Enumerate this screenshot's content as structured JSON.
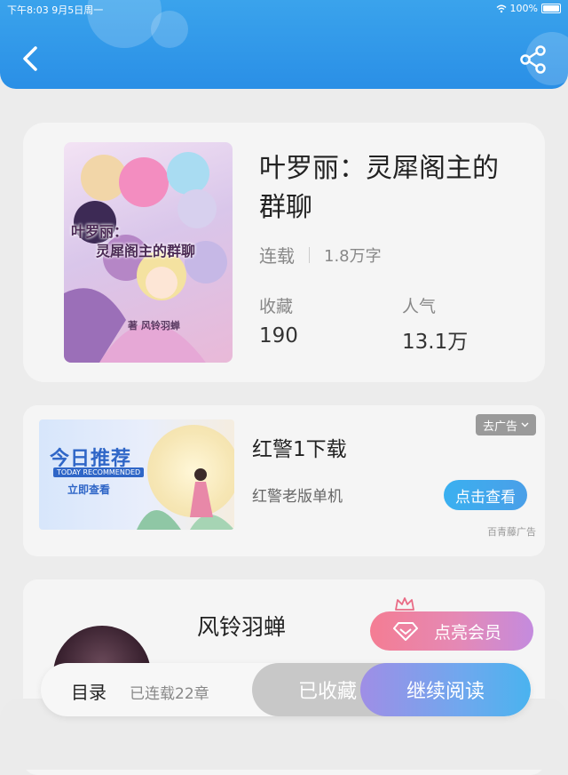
{
  "status_bar": {
    "time": "下午8:03 9月5日周一",
    "battery": "100%"
  },
  "book": {
    "title": "叶罗丽：灵犀阁主的群聊",
    "cover_title_line1": "叶罗丽：",
    "cover_title_line2": "灵犀阁主的群聊",
    "cover_author": "著 风铃羽蝉",
    "status": "连载",
    "word_count": "1.8万字",
    "stats": [
      {
        "label": "收藏",
        "value": "190"
      },
      {
        "label": "人气",
        "value": "13.1万"
      }
    ]
  },
  "ad": {
    "image_headline": "今日推荐",
    "image_subheadline": "TODAY RECOMMENDED",
    "image_cta": "立即查看",
    "title": "红警1下载",
    "subtitle": "红警老版单机",
    "close_label": "去广告",
    "button_label": "点击查看",
    "source": "百青藤广告"
  },
  "author": {
    "name": "风铃羽蝉",
    "vip_button_label": "点亮会员"
  },
  "bottom_bar": {
    "toc_label": "目录",
    "chapters_label": "已连载22章",
    "collected_label": "已收藏",
    "continue_label": "继续阅读"
  },
  "colors": {
    "header_blue": "#2a8fe6",
    "accent_blue": "#3ab0f0",
    "vip_pink": "#f47d93",
    "vip_purple": "#c48bde"
  },
  "icons": [
    "back-icon",
    "share-icon",
    "wifi-icon",
    "battery-icon",
    "chevron-down-icon",
    "crown-icon",
    "diamond-icon"
  ]
}
